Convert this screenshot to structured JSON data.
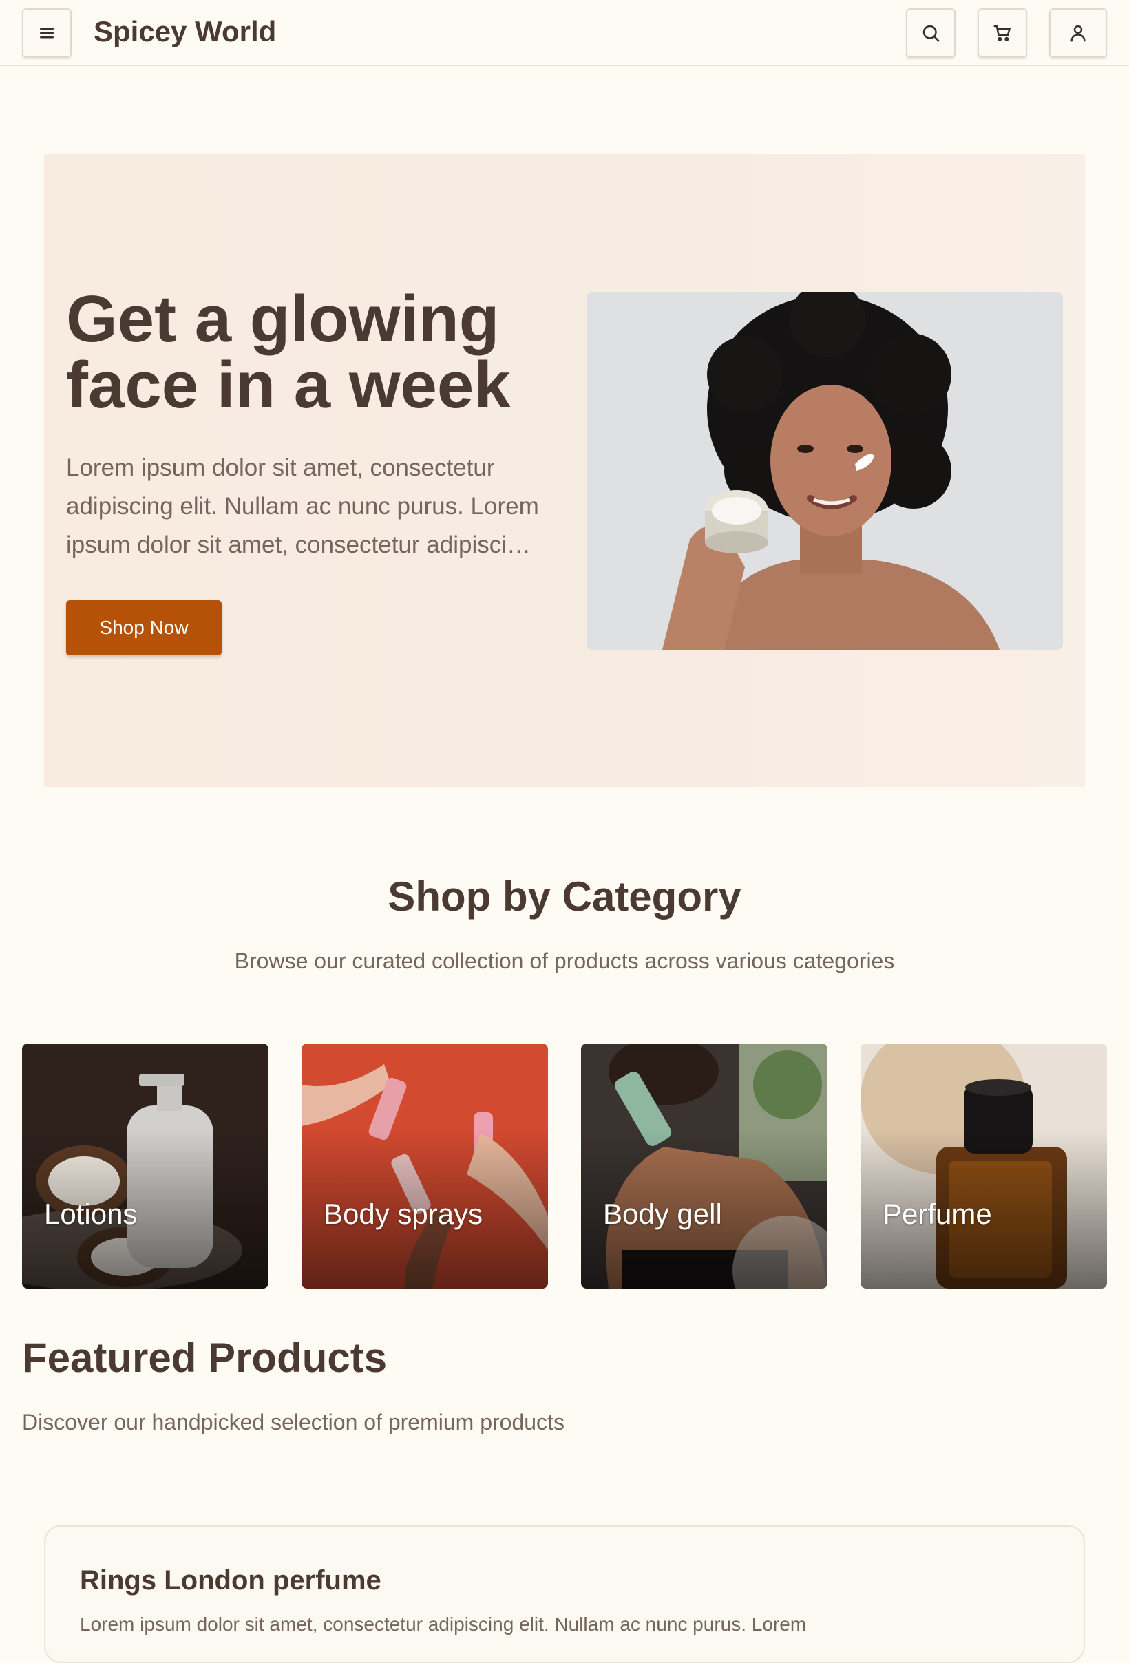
{
  "header": {
    "brand": "Spicey World",
    "menu_icon": "menu-icon",
    "search_icon": "search-icon",
    "cart_icon": "cart-icon",
    "user_icon": "user-icon"
  },
  "hero": {
    "title_line1": "Get a glowing",
    "title_line2": "face in a week",
    "text": "Lorem ipsum dolor sit amet, consectetur adipiscing elit. Nullam ac nunc purus. Lorem ipsum dolor sit amet, consectetur adipiscing elit.",
    "button_label": "Shop Now",
    "button_color": "#b55207"
  },
  "categories": {
    "title": "Shop by Category",
    "subtitle": "Browse our curated collection of products across various categories",
    "items": [
      {
        "label": "Lotions"
      },
      {
        "label": "Body sprays"
      },
      {
        "label": "Body gell"
      },
      {
        "label": "Perfume"
      }
    ]
  },
  "featured": {
    "title": "Featured Products",
    "subtitle": "Discover our handpicked selection of premium products",
    "products": [
      {
        "name": "Rings London perfume",
        "description": "Lorem ipsum dolor sit amet, consectetur adipiscing elit. Nullam ac nunc purus. Lorem"
      }
    ]
  }
}
